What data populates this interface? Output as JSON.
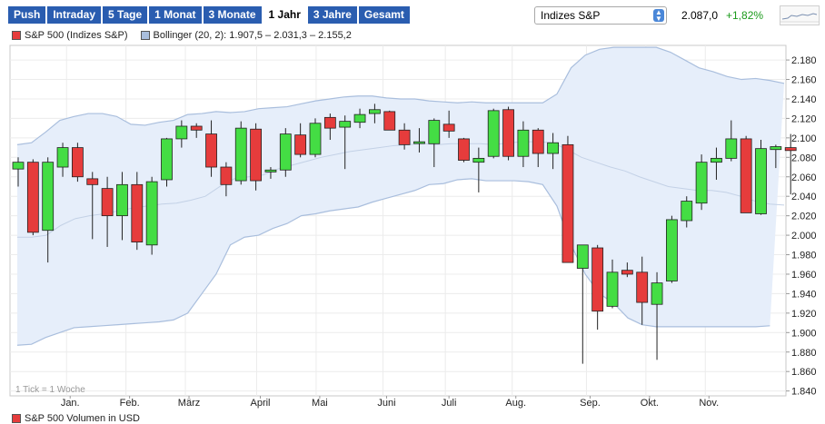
{
  "tabs": [
    {
      "label": "Push",
      "active": false
    },
    {
      "label": "Intraday",
      "active": false
    },
    {
      "label": "5 Tage",
      "active": false
    },
    {
      "label": "1 Monat",
      "active": false
    },
    {
      "label": "3 Monate",
      "active": false
    },
    {
      "label": "1 Jahr",
      "active": true
    },
    {
      "label": "3 Jahre",
      "active": false
    },
    {
      "label": "Gesamt",
      "active": false
    }
  ],
  "index_select": {
    "value": "Indizes S&P"
  },
  "quote": {
    "price": "2.087,0",
    "change": "+1,82%"
  },
  "colors": {
    "up": "#44dd44",
    "down": "#e63c3c",
    "band_fill": "#e6eefa",
    "band_line": "#a9bedd",
    "change": "#1a9a1a",
    "tab_bg": "#2a5db0"
  },
  "legend": {
    "series_label": "S&P 500 (Indizes S&P)",
    "bollinger_label": "Bollinger (20, 2): 1.907,5 – 2.031,3 – 2.155,2"
  },
  "note": "1 Tick = 1 Woche",
  "volume_legend": "S&P 500 Volumen in USD",
  "chart_data": {
    "type": "candlestick",
    "ylim": [
      1835,
      2195
    ],
    "y_ticks": [
      "2.180",
      "2.160",
      "2.140",
      "2.120",
      "2.100",
      "2.080",
      "2.060",
      "2.040",
      "2.020",
      "2.000",
      "1.980",
      "1.960",
      "1.940",
      "1.920",
      "1.900",
      "1.880",
      "1.860",
      "1.840"
    ],
    "y_tick_values": [
      2180,
      2160,
      2140,
      2120,
      2100,
      2080,
      2060,
      2040,
      2020,
      2000,
      1980,
      1960,
      1940,
      1920,
      1900,
      1880,
      1860,
      1840
    ],
    "x_labels": [
      "Jan.",
      "Feb.",
      "März",
      "April",
      "Mai",
      "Juni",
      "Juli",
      "Aug.",
      "Sep.",
      "Okt.",
      "Nov."
    ],
    "x_label_weeks": [
      4.5,
      8.5,
      12.5,
      17.3,
      21.3,
      25.8,
      30,
      34.5,
      39.5,
      43.5,
      47.5
    ],
    "grid": true,
    "candles": [
      {
        "o": 2068,
        "h": 2080,
        "l": 2050,
        "c": 2075
      },
      {
        "o": 2075,
        "h": 2078,
        "l": 2000,
        "c": 2003
      },
      {
        "o": 2005,
        "h": 2080,
        "l": 1972,
        "c": 2075
      },
      {
        "o": 2070,
        "h": 2095,
        "l": 2060,
        "c": 2090
      },
      {
        "o": 2090,
        "h": 2095,
        "l": 2055,
        "c": 2060
      },
      {
        "o": 2058,
        "h": 2065,
        "l": 1996,
        "c": 2052
      },
      {
        "o": 2048,
        "h": 2060,
        "l": 1988,
        "c": 2020
      },
      {
        "o": 2020,
        "h": 2065,
        "l": 1995,
        "c": 2052
      },
      {
        "o": 2052,
        "h": 2065,
        "l": 1985,
        "c": 1993
      },
      {
        "o": 1990,
        "h": 2060,
        "l": 1980,
        "c": 2055
      },
      {
        "o": 2057,
        "h": 2100,
        "l": 2050,
        "c": 2099
      },
      {
        "o": 2099,
        "h": 2118,
        "l": 2090,
        "c": 2112
      },
      {
        "o": 2112,
        "h": 2115,
        "l": 2100,
        "c": 2108
      },
      {
        "o": 2104,
        "h": 2118,
        "l": 2060,
        "c": 2070
      },
      {
        "o": 2070,
        "h": 2075,
        "l": 2040,
        "c": 2052
      },
      {
        "o": 2056,
        "h": 2117,
        "l": 2052,
        "c": 2110
      },
      {
        "o": 2109,
        "h": 2115,
        "l": 2046,
        "c": 2056
      },
      {
        "o": 2065,
        "h": 2070,
        "l": 2058,
        "c": 2067
      },
      {
        "o": 2067,
        "h": 2110,
        "l": 2060,
        "c": 2104
      },
      {
        "o": 2103,
        "h": 2115,
        "l": 2080,
        "c": 2083
      },
      {
        "o": 2083,
        "h": 2120,
        "l": 2080,
        "c": 2115
      },
      {
        "o": 2121,
        "h": 2125,
        "l": 2098,
        "c": 2110
      },
      {
        "o": 2111,
        "h": 2123,
        "l": 2068,
        "c": 2117
      },
      {
        "o": 2116,
        "h": 2130,
        "l": 2110,
        "c": 2124
      },
      {
        "o": 2125,
        "h": 2135,
        "l": 2115,
        "c": 2129
      },
      {
        "o": 2127,
        "h": 2128,
        "l": 2110,
        "c": 2108
      },
      {
        "o": 2108,
        "h": 2115,
        "l": 2088,
        "c": 2093
      },
      {
        "o": 2095,
        "h": 2110,
        "l": 2085,
        "c": 2096
      },
      {
        "o": 2094,
        "h": 2120,
        "l": 2070,
        "c": 2118
      },
      {
        "o": 2114,
        "h": 2128,
        "l": 2100,
        "c": 2107
      },
      {
        "o": 2099,
        "h": 2100,
        "l": 2075,
        "c": 2077
      },
      {
        "o": 2075,
        "h": 2090,
        "l": 2044,
        "c": 2079
      },
      {
        "o": 2081,
        "h": 2130,
        "l": 2079,
        "c": 2128
      },
      {
        "o": 2129,
        "h": 2132,
        "l": 2077,
        "c": 2081
      },
      {
        "o": 2081,
        "h": 2117,
        "l": 2070,
        "c": 2108
      },
      {
        "o": 2108,
        "h": 2110,
        "l": 2070,
        "c": 2084
      },
      {
        "o": 2084,
        "h": 2105,
        "l": 2068,
        "c": 2095
      },
      {
        "o": 2093,
        "h": 2102,
        "l": 2060,
        "c": 1972
      },
      {
        "o": 1966,
        "h": 1990,
        "l": 1868,
        "c": 1990
      },
      {
        "o": 1987,
        "h": 1990,
        "l": 1903,
        "c": 1922
      },
      {
        "o": 1927,
        "h": 1975,
        "l": 1925,
        "c": 1962
      },
      {
        "o": 1964,
        "h": 1972,
        "l": 1957,
        "c": 1960
      },
      {
        "o": 1962,
        "h": 1978,
        "l": 1908,
        "c": 1931
      },
      {
        "o": 1929,
        "h": 1962,
        "l": 1872,
        "c": 1951
      },
      {
        "o": 1953,
        "h": 2020,
        "l": 1951,
        "c": 2016
      },
      {
        "o": 2015,
        "h": 2040,
        "l": 2008,
        "c": 2035
      },
      {
        "o": 2033,
        "h": 2083,
        "l": 2026,
        "c": 2075
      },
      {
        "o": 2075,
        "h": 2090,
        "l": 2057,
        "c": 2079
      },
      {
        "o": 2079,
        "h": 2118,
        "l": 2076,
        "c": 2099
      },
      {
        "o": 2099,
        "h": 2102,
        "l": 2025,
        "c": 2023
      },
      {
        "o": 2022,
        "h": 2098,
        "l": 2021,
        "c": 2089
      },
      {
        "o": 2088,
        "h": 2093,
        "l": 2069,
        "c": 2091
      },
      {
        "o": 2090,
        "h": 2104,
        "l": 2042,
        "c": 2087
      }
    ],
    "bollinger": {
      "upper": [
        2093,
        2095,
        2106,
        2118,
        2122,
        2125,
        2125,
        2122,
        2114,
        2113,
        2116,
        2118,
        2124,
        2125,
        2127,
        2126,
        2127,
        2130,
        2131,
        2132,
        2135,
        2138,
        2140,
        2142,
        2143,
        2143,
        2141,
        2140,
        2140,
        2138,
        2137,
        2136,
        2137,
        2136,
        2136,
        2136,
        2136,
        2136,
        2145,
        2172,
        2185,
        2191,
        2193,
        2193,
        2193,
        2193,
        2188,
        2180,
        2172,
        2168,
        2163,
        2160,
        2161,
        2159,
        2156
      ],
      "middle": [
        1998,
        1998,
        2000,
        2010,
        2017,
        2020,
        2022,
        2025,
        2028,
        2030,
        2032,
        2033,
        2036,
        2040,
        2050,
        2058,
        2060,
        2062,
        2068,
        2072,
        2076,
        2080,
        2083,
        2086,
        2088,
        2090,
        2092,
        2093,
        2094,
        2093,
        2094,
        2094,
        2094,
        2093,
        2095,
        2096,
        2096,
        2095,
        2088,
        2080,
        2075,
        2070,
        2066,
        2060,
        2055,
        2050,
        2048,
        2046,
        2046,
        2044,
        2040,
        2035,
        2032,
        2031
      ],
      "lower": [
        1887,
        1888,
        1895,
        1900,
        1905,
        1906,
        1907,
        1908,
        1909,
        1910,
        1911,
        1913,
        1920,
        1940,
        1960,
        1990,
        1998,
        2000,
        2007,
        2012,
        2020,
        2022,
        2025,
        2027,
        2029,
        2034,
        2038,
        2042,
        2046,
        2052,
        2053,
        2057,
        2058,
        2056,
        2056,
        2056,
        2055,
        2052,
        2030,
        1990,
        1960,
        1940,
        1930,
        1915,
        1908,
        1906,
        1906,
        1906,
        1906,
        1906,
        1906,
        1906,
        1906,
        1907
      ]
    }
  }
}
